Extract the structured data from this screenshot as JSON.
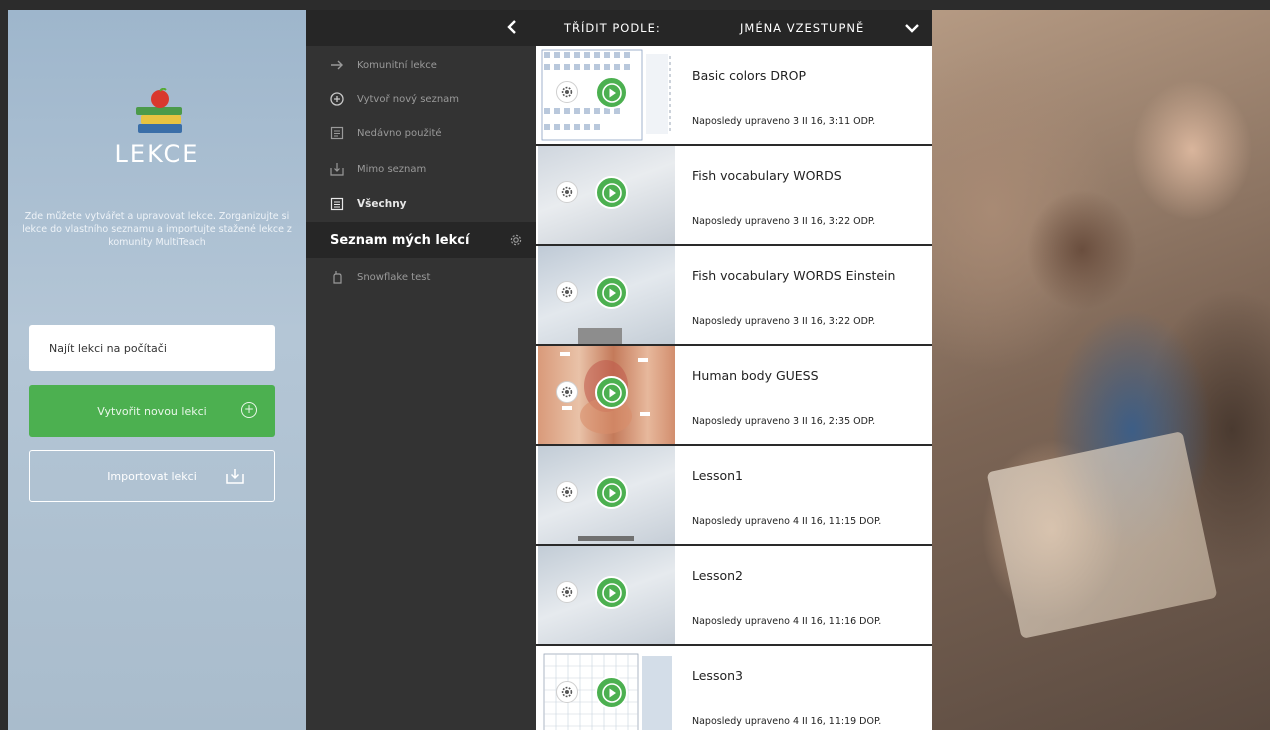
{
  "sidebar": {
    "app_title": "LEKCE",
    "description": "Zde můžete vytvářet a upravovat lekce. Zorganizujte si lekce do vlastního seznamu a importujte stažené lekce z komunity MultiTeach",
    "find_button": "Najít lekci na počítači",
    "create_button": "Vytvořit novou lekci",
    "import_button": "Importovat lekci"
  },
  "nav": {
    "items": [
      {
        "label": "Komunitní lekce",
        "icon": "arrow-icon"
      },
      {
        "label": "Vytvoř nový seznam",
        "icon": "plus-circle-icon"
      },
      {
        "label": "Nedávno použité",
        "icon": "recent-icon"
      },
      {
        "label": "Mimo seznam",
        "icon": "download-icon"
      },
      {
        "label": "Všechny",
        "icon": "list-icon"
      },
      {
        "label": "Seznam mých lekcí",
        "icon": "gear-icon"
      },
      {
        "label": "Snowflake test",
        "icon": "hand-icon"
      }
    ]
  },
  "header": {
    "sort_label": "TŘÍDIT PODLE:",
    "sort_value": "JMÉNA VZESTUPNĚ"
  },
  "lessons": [
    {
      "title": "Basic colors DROP",
      "modified": "Naposledy upraveno 3 II 16, 3:11 ODP."
    },
    {
      "title": "Fish vocabulary WORDS",
      "modified": "Naposledy upraveno 3 II 16, 3:22 ODP."
    },
    {
      "title": "Fish vocabulary WORDS Einstein",
      "modified": "Naposledy upraveno 3 II 16, 3:22 ODP."
    },
    {
      "title": "Human body GUESS",
      "modified": "Naposledy upraveno 3 II 16, 2:35 ODP."
    },
    {
      "title": "Lesson1",
      "modified": "Naposledy upraveno 4 II 16, 11:15 DOP."
    },
    {
      "title": "Lesson2",
      "modified": "Naposledy upraveno 4 II 16, 11:16 DOP."
    },
    {
      "title": "Lesson3",
      "modified": "Naposledy upraveno 4 II 16, 11:19 DOP."
    }
  ],
  "colors": {
    "accent_green": "#4cb050",
    "panel_dark": "#333333",
    "header_dark": "#262626",
    "sidebar_blue": "#a9bccc"
  }
}
